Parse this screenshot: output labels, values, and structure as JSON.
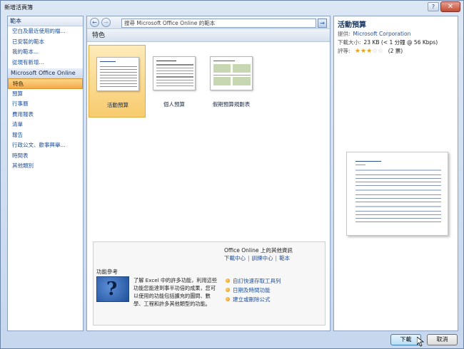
{
  "window": {
    "title": "新增活頁簿",
    "help_icon": "?",
    "close_icon": "✕"
  },
  "left_pane": {
    "header": "範本",
    "items": [
      "空白及最近使用的檔...",
      "已安裝的範本",
      "我的範本...",
      "從現有新增..."
    ],
    "section": "Microsoft Office Online",
    "online_items": [
      "特色",
      "預算",
      "行事曆",
      "費用報表",
      "清單",
      "報告",
      "行政公文、歡事興舉...",
      "時間表",
      "其他類別"
    ],
    "selected_index": 0
  },
  "nav": {
    "back_icon": "←",
    "forward_icon": "→",
    "search_placeholder": "搜尋 Microsoft Office Online 的範本",
    "go_icon": "→"
  },
  "center": {
    "section_title": "特色",
    "templates": [
      {
        "label": "活動預算"
      },
      {
        "label": "個人預算"
      },
      {
        "label": "假期預算規劃表"
      }
    ],
    "more_info": {
      "title": "Office Online 上的其他資訊",
      "links": [
        "下載中心",
        "訓練中心",
        "範本"
      ],
      "ref_title": "功能參考",
      "image_glyph": "?",
      "description": "了解 Excel 中的許多功能，利用這些功能您能達到事半功倍的成果，您可以使用的功能包括擴充的圖間、數學、工程和許多其他類型的功能。",
      "list": [
        "自訂快速存取工具列",
        "日期及時間功能",
        "建立或刪除公式"
      ]
    }
  },
  "details": {
    "title": "活動預算",
    "provider_label": "提供:",
    "provider": "Microsoft Corporation",
    "size_label": "下載大小:",
    "size": "23 KB (< 1 分鐘 @ 56 Kbps)",
    "rating_label": "評等:",
    "rating_stars": 3,
    "rating_max": 5,
    "rating_votes": "(2 票)"
  },
  "buttons": {
    "download": "下載",
    "cancel": "取消"
  },
  "colors": {
    "accent": "#1f4f9b",
    "selection": "#f8cb6d",
    "frame": "#c6d7ee"
  }
}
